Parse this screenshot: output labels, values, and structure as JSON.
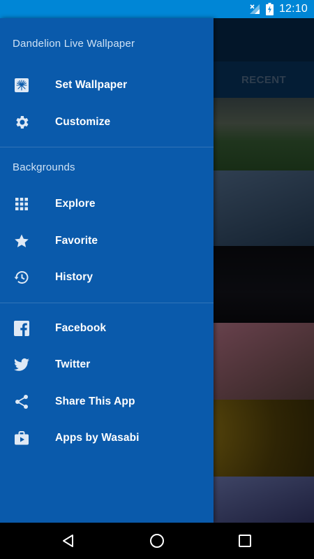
{
  "status_bar": {
    "time": "12:10",
    "icons": [
      "signal-off-icon",
      "battery-charging-icon"
    ]
  },
  "app": {
    "tab_recent_label": "RECENT"
  },
  "drawer": {
    "title": "Dandelion Live Wallpaper",
    "top_items": [
      {
        "label": "Set Wallpaper",
        "icon": "wallpaper-icon"
      },
      {
        "label": "Customize",
        "icon": "gear-icon"
      }
    ],
    "backgrounds_section": {
      "header": "Backgrounds",
      "items": [
        {
          "label": "Explore",
          "icon": "grid-icon"
        },
        {
          "label": "Favorite",
          "icon": "star-icon"
        },
        {
          "label": "History",
          "icon": "history-icon"
        }
      ]
    },
    "social_items": [
      {
        "label": "Facebook",
        "icon": "facebook-icon"
      },
      {
        "label": "Twitter",
        "icon": "twitter-icon"
      },
      {
        "label": "Share This App",
        "icon": "share-icon"
      },
      {
        "label": "Apps by Wasabi",
        "icon": "store-icon"
      }
    ]
  },
  "colors": {
    "status_bar": "#0086d6",
    "drawer_background": "#0a5aab",
    "drawer_text": "#ffffff",
    "section_header_text": "#cfe2f5"
  },
  "system_nav": {
    "buttons": [
      "back-icon",
      "home-icon",
      "recents-icon"
    ]
  }
}
